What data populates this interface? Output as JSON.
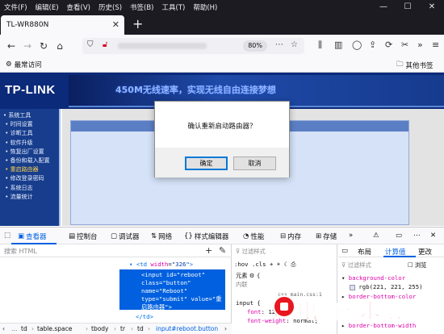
{
  "menubar": {
    "items": [
      "文件(F)",
      "编辑(E)",
      "查看(V)",
      "历史(S)",
      "书签(B)",
      "工具(T)",
      "帮助(H)"
    ]
  },
  "window_controls": {
    "minimize": "—",
    "maximize": "☐",
    "close": "✕"
  },
  "tab": {
    "title": "TL-WR880N",
    "close": "✕"
  },
  "newtab": "+",
  "navbar": {
    "zoom": "80%"
  },
  "bookmarks": {
    "frequent": "最常访问",
    "other": "其他书签"
  },
  "tplink": {
    "logo": "TP-LINK",
    "slogan": "450M无线速率，实现无线自由连接梦想",
    "menu": [
      "系统工具",
      "时间设置",
      "诊断工具",
      "软件升级",
      "恢复出厂设置",
      "备份和载入配置",
      "重启路由器",
      "修改登录密码",
      "系统日志",
      "流量统计"
    ]
  },
  "dialog": {
    "message": "确认重新启动路由器？",
    "ok": "确定",
    "cancel": "取消"
  },
  "devtools": {
    "tabs": [
      "查看器",
      "控制台",
      "调试器",
      "网络",
      "样式编辑器",
      "性能",
      "内存",
      "存储"
    ],
    "search_placeholder": "搜索 HTML",
    "code": {
      "line1_tag": "<td",
      "line1_attr": "width",
      "line1_val": "\"326\"",
      "line1_end": ">",
      "sel1": "<input id=\"reboot\"",
      "sel2": "class=\"button\"",
      "sel3": "name=\"Reboot\"",
      "sel4": "type=\"submit\" value=\"重",
      "sel5": "启路由器\">",
      "close_td": "</td>"
    },
    "breadcrumb": [
      "td",
      "table.space",
      "tbody",
      "tr",
      "td",
      "input#reboot.button"
    ],
    "rules": {
      "filter_placeholder": "过滤样式",
      "toggles": [
        ":hov",
        ".cls"
      ],
      "element_label": "元素",
      "element_brace": "{",
      "inline_label": "内联",
      "source": "css_main.css:1",
      "selector": "input {",
      "props": [
        {
          "name": "font",
          "value": "12px"
        },
        {
          "name": "font-weight",
          "value": "normal;"
        }
      ]
    },
    "computed": {
      "tabs": [
        "布局",
        "计算值",
        "更改"
      ],
      "filter_placeholder": "过滤样式",
      "browser_styles": "浏览",
      "props": [
        {
          "name": "background-color",
          "value": "rgb(221, 221, 255)"
        },
        {
          "name": "border-bottom-color",
          "value": ""
        },
        {
          "name": "border-bottom-width",
          "value": ""
        }
      ]
    }
  },
  "watermark": {
    "text": "电脑技术吧"
  }
}
